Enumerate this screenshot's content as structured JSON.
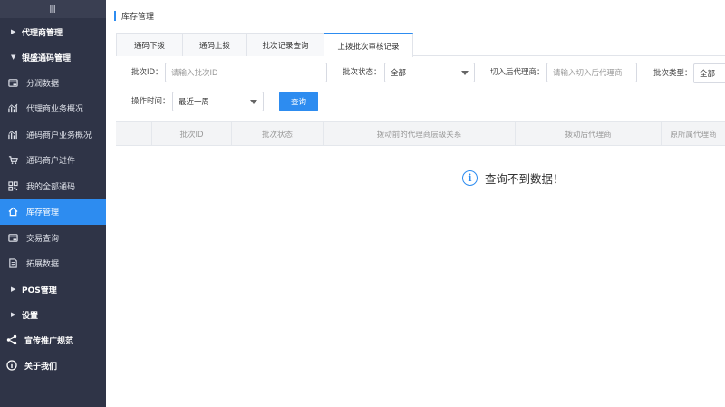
{
  "sidebar": {
    "top_icon": "Ⅲ",
    "groups": {
      "agent_mgmt": "代理商管理",
      "code_mgmt": "银盛通码管理",
      "pos_mgmt": "POS管理",
      "settings": "设置"
    },
    "items": [
      {
        "label": "分润数据",
        "icon": "card-icon"
      },
      {
        "label": "代理商业务概况",
        "icon": "chart-icon"
      },
      {
        "label": "通码商户业务概况",
        "icon": "chart-icon"
      },
      {
        "label": "通码商户进件",
        "icon": "cart-icon"
      },
      {
        "label": "我的全部通码",
        "icon": "qrcode-icon"
      },
      {
        "label": "库存管理",
        "icon": "home-icon"
      },
      {
        "label": "交易查询",
        "icon": "card-icon"
      },
      {
        "label": "拓展数据",
        "icon": "document-icon"
      }
    ],
    "links": {
      "promo": "宣传推广规范",
      "about": "关于我们"
    }
  },
  "header": {
    "title": "库存管理"
  },
  "tabs": [
    "通码下拨",
    "通码上拨",
    "批次记录查询",
    "上拨批次审核记录"
  ],
  "filters": {
    "batch_id_label": "批次ID：",
    "batch_id_placeholder": "请输入批次ID",
    "batch_status_label": "批次状态：",
    "batch_status_value": "全部",
    "switch_agent_label": "切入后代理商：",
    "switch_agent_placeholder": "请输入切入后代理商",
    "batch_type_label": "批次类型：",
    "batch_type_value": "全部",
    "op_time_label": "操作时间：",
    "op_time_value": "最近一周",
    "query_button": "查询"
  },
  "table": {
    "columns": [
      "批次ID",
      "批次状态",
      "拨动前的代理商层级关系",
      "拨动后代理商",
      "原所属代理商"
    ]
  },
  "empty_message": "查询不到数据！",
  "colors": {
    "accent": "#2d8cf0",
    "sidebar_bg": "#2f3447"
  }
}
